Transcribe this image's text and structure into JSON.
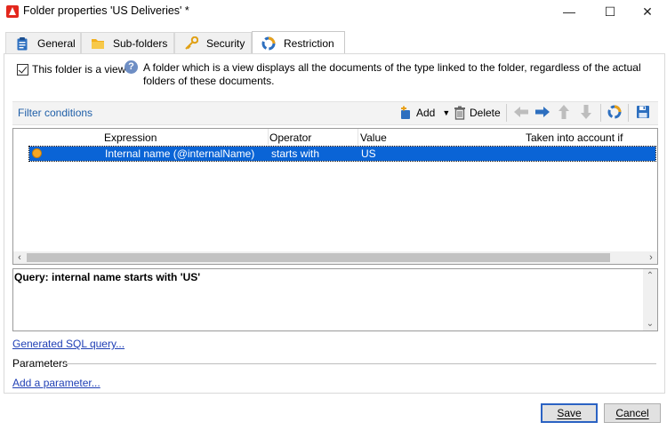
{
  "window": {
    "title": "Folder properties 'US Deliveries' *",
    "minimize": "—",
    "maximize": "☐",
    "close": "✕"
  },
  "tabs": [
    {
      "label": "General",
      "icon": "clipboard-icon"
    },
    {
      "label": "Sub-folders",
      "icon": "folder-icon"
    },
    {
      "label": "Security",
      "icon": "key-icon"
    },
    {
      "label": "Restriction",
      "icon": "restriction-icon",
      "active": true
    }
  ],
  "view_option": {
    "checkbox_label": "This folder is a view",
    "checked": true,
    "info": "A folder which is a view displays all the documents of the type linked to the folder, regardless of the actual folders of these documents."
  },
  "filter": {
    "title": "Filter conditions",
    "add_label": "Add",
    "delete_label": "Delete"
  },
  "grid": {
    "columns": [
      "Expression",
      "Operator",
      "Value",
      "Taken into account if"
    ],
    "rows": [
      {
        "expression": "Internal name (@internalName)",
        "operator": "starts with",
        "value": "US",
        "condition": ""
      }
    ]
  },
  "query": {
    "text": "Query: internal name starts with 'US'"
  },
  "links": {
    "sql": "Generated SQL query...",
    "add_param": "Add a parameter..."
  },
  "params_label": "Parameters",
  "buttons": {
    "save": "Save",
    "cancel": "Cancel"
  },
  "colors": {
    "selection": "#0a64d6",
    "link": "#1f3fb5",
    "accent": "#1f5fa8"
  }
}
